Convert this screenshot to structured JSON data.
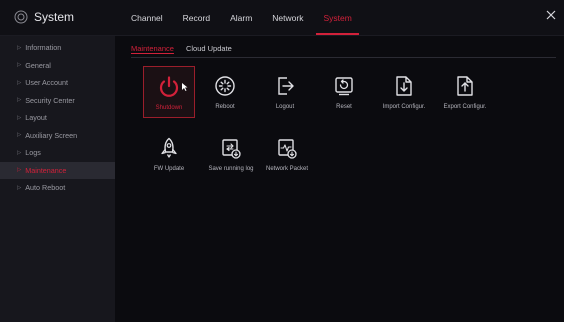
{
  "app": {
    "title": "System",
    "icon": "gear-icon"
  },
  "topnav": {
    "tabs": [
      {
        "label": "Channel",
        "active": false
      },
      {
        "label": "Record",
        "active": false
      },
      {
        "label": "Alarm",
        "active": false
      },
      {
        "label": "Network",
        "active": false
      },
      {
        "label": "System",
        "active": true
      }
    ]
  },
  "sidebar": {
    "items": [
      {
        "label": "Information",
        "active": false
      },
      {
        "label": "General",
        "active": false
      },
      {
        "label": "User Account",
        "active": false
      },
      {
        "label": "Security Center",
        "active": false
      },
      {
        "label": "Layout",
        "active": false
      },
      {
        "label": "Auxiliary Screen",
        "active": false
      },
      {
        "label": "Logs",
        "active": false
      },
      {
        "label": "Maintenance",
        "active": true
      },
      {
        "label": "Auto Reboot",
        "active": false
      }
    ]
  },
  "main": {
    "subtabs": [
      {
        "label": "Maintenance",
        "active": true
      },
      {
        "label": "Cloud Update",
        "active": false
      }
    ],
    "tiles": [
      {
        "label": "Shutdown",
        "icon": "power-icon",
        "active": true
      },
      {
        "label": "Reboot",
        "icon": "reboot-icon",
        "active": false
      },
      {
        "label": "Logout",
        "icon": "logout-icon",
        "active": false
      },
      {
        "label": "Reset",
        "icon": "reset-icon",
        "active": false
      },
      {
        "label": "Import Configur.",
        "icon": "import-config-icon",
        "active": false
      },
      {
        "label": "Export Configur.",
        "icon": "export-config-icon",
        "active": false
      },
      {
        "label": "FW Update",
        "icon": "rocket-icon",
        "active": false
      },
      {
        "label": "Save running log",
        "icon": "save-log-icon",
        "active": false
      },
      {
        "label": "Network Packet",
        "icon": "network-packet-icon",
        "active": false
      }
    ]
  },
  "colors": {
    "accent": "#d2213a",
    "background": "#0b0b0f",
    "sidebar": "#17171d"
  }
}
